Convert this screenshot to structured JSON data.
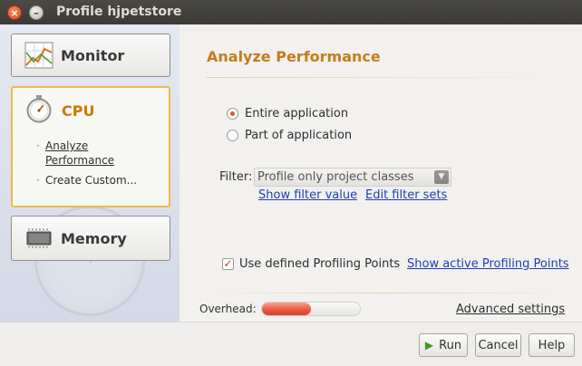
{
  "window": {
    "title": "Profile hjpetstore",
    "close_glyph": "×",
    "minimize_glyph": "–"
  },
  "sidebar": {
    "monitor_label": "Monitor",
    "cpu_label": "CPU",
    "cpu_links": [
      {
        "label": "Analyze Performance",
        "active": true
      },
      {
        "label": "Create Custom...",
        "active": false
      }
    ],
    "memory_label": "Memory",
    "bullet": "·"
  },
  "main": {
    "title": "Analyze Performance",
    "radio_entire": "Entire application",
    "radio_part": "Part of application",
    "radio_selected": "entire",
    "filter_label": "Filter:",
    "filter_value": "Profile only project classes",
    "show_filter_link": "Show filter value",
    "edit_filter_link": "Edit filter sets",
    "use_points_label": "Use defined Profiling Points",
    "use_points_checked": true,
    "show_points_link": "Show active Profiling Points",
    "overhead_label": "Overhead:",
    "overhead_level": 0.5,
    "advanced_link": "Advanced settings"
  },
  "footer": {
    "run_label": "Run",
    "cancel_label": "Cancel",
    "help_label": "Help"
  },
  "colors": {
    "accent_orange": "#c57c1a",
    "cpu_border": "#f0b948",
    "link_blue": "#1f3fb4",
    "overhead_red": "#e8533a"
  }
}
